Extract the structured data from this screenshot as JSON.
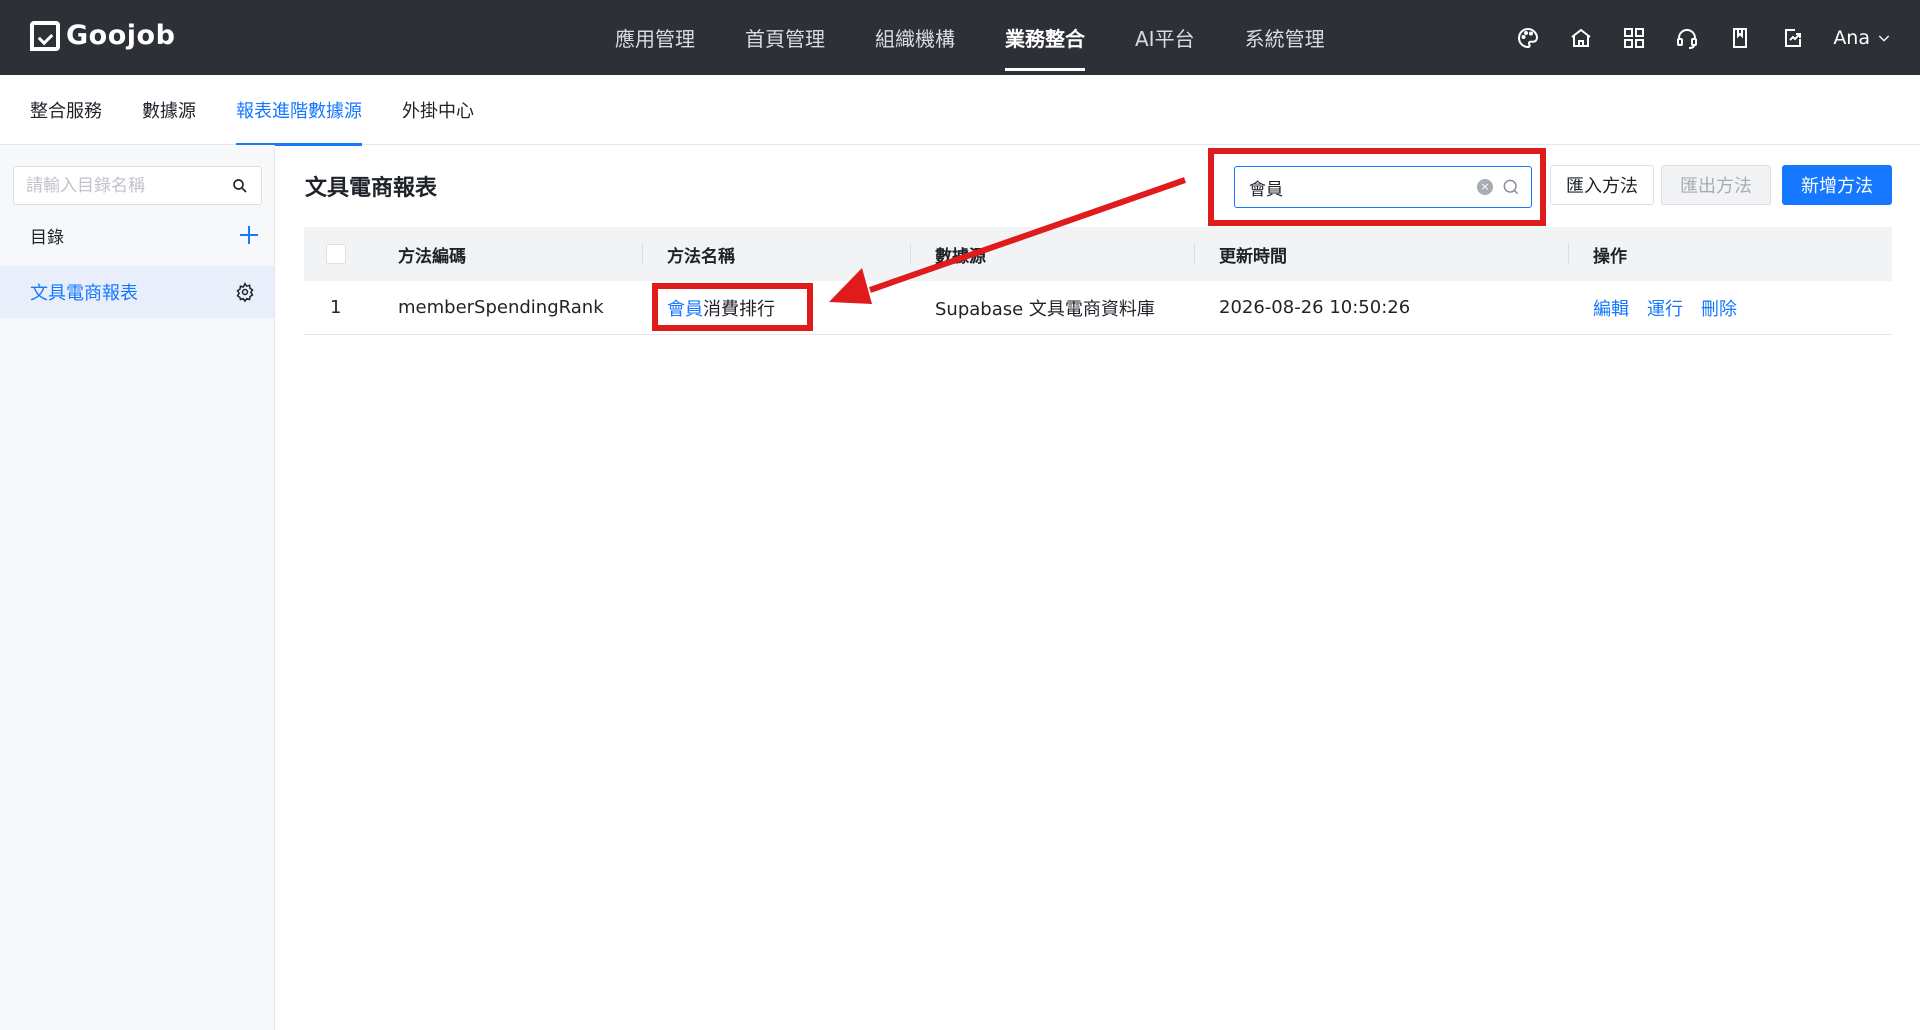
{
  "app": {
    "logo_text": "Goojob"
  },
  "topnav": {
    "items": [
      "應用管理",
      "首頁管理",
      "組織機構",
      "業務整合",
      "AI平台",
      "系統管理"
    ],
    "active_index": 3
  },
  "topbar_icons": [
    "palette-icon",
    "home-icon",
    "grid-icon",
    "headset-icon",
    "bookmark-icon",
    "export-icon"
  ],
  "user": {
    "name": "Ana"
  },
  "subtabs": {
    "items": [
      "整合服務",
      "數據源",
      "報表進階數據源",
      "外掛中心"
    ],
    "active_index": 2
  },
  "sidebar": {
    "search_placeholder": "請輸入目錄名稱",
    "header_label": "目錄",
    "items": [
      {
        "label": "文具電商報表"
      }
    ]
  },
  "main": {
    "title": "文具電商報表",
    "search": {
      "value": "會員"
    },
    "buttons": {
      "import": "匯入方法",
      "export": "匯出方法",
      "new": "新增方法"
    }
  },
  "table": {
    "columns": [
      "方法編碼",
      "方法名稱",
      "數據源",
      "更新時間",
      "操作"
    ],
    "rows": [
      {
        "index": "1",
        "code": "memberSpendingRank",
        "name_match": "會員",
        "name_rest": "消費排行",
        "source": "Supabase 文具電商資料庫",
        "updated": "2026-08-26 10:50:26",
        "actions": [
          "編輯",
          "運行",
          "刪除"
        ]
      }
    ]
  },
  "colors": {
    "topbar_bg": "#2d3036",
    "accent": "#1677ff",
    "highlight_red": "#e01b1b"
  }
}
